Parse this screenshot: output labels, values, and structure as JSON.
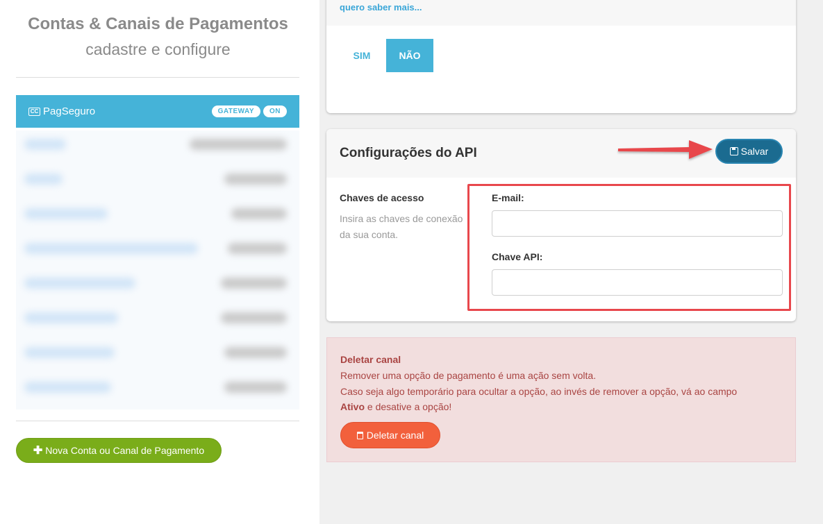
{
  "sidebar": {
    "title": "Contas & Canais de Pagamentos",
    "subtitle": "cadastre e configure",
    "active_channel": {
      "icon": "credit-card-icon",
      "icon_text": "CC",
      "name": "PagSeguro",
      "badges": [
        "GATEWAY",
        "ON"
      ]
    },
    "new_button_label": "Nova Conta ou Canal de Pagamento"
  },
  "active_panel": {
    "learn_more_link": "quero saber mais...",
    "toggle": {
      "yes_label": "SIM",
      "no_label": "NÃO",
      "selected": "NÃO"
    }
  },
  "api_panel": {
    "title": "Configurações do API",
    "save_label": "Salvar",
    "keys_label": "Chaves de acesso",
    "keys_desc": "Insira as chaves de conexão da sua conta.",
    "email_label": "E-mail:",
    "email_value": "",
    "api_key_label": "Chave API:",
    "api_key_value": ""
  },
  "danger_panel": {
    "title": "Deletar canal",
    "line1": "Remover uma opção de pagamento é uma ação sem volta.",
    "line2": "Caso seja algo temporário para ocultar a opção, ao invés de remover a opção, vá ao campo",
    "line3_bold": "Ativo",
    "line3_rest": " e desative a opção!",
    "delete_label": "Deletar canal"
  },
  "colors": {
    "accent": "#45b3d8",
    "save": "#1b6b90",
    "new_button": "#7aad1a",
    "danger_bg": "#f2dede",
    "danger_text": "#a94442",
    "delete_button": "#f2603c",
    "annotation": "#e8474c"
  }
}
